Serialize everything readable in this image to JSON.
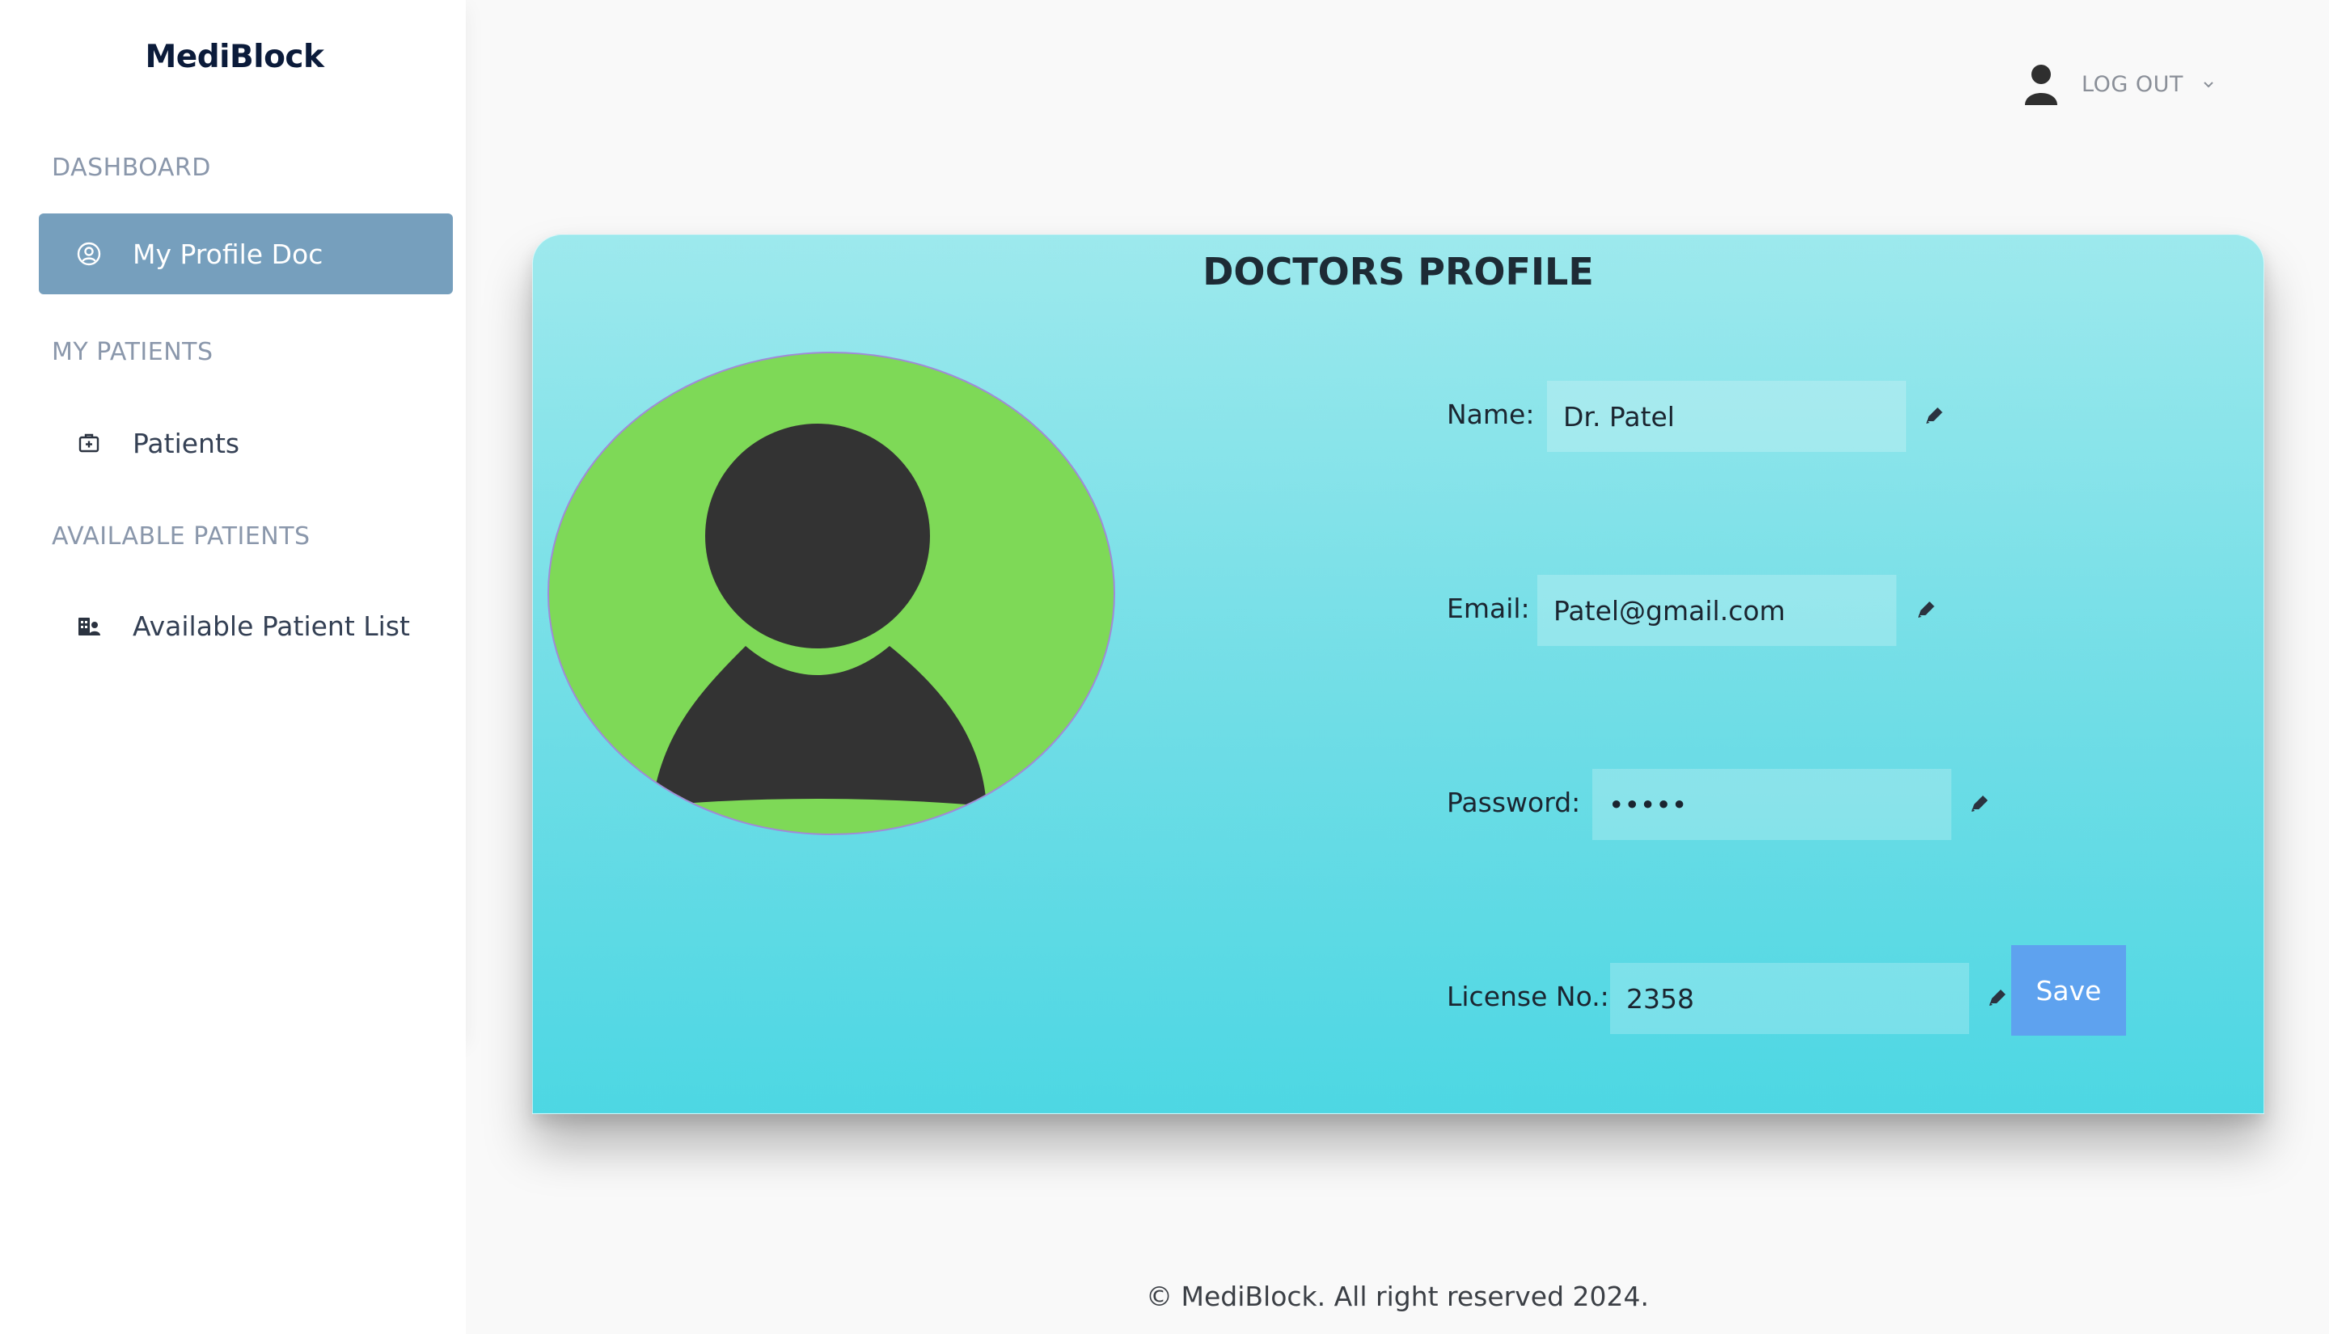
{
  "sidebar": {
    "brand": "MediBlock",
    "sections": [
      {
        "label": "DASHBOARD"
      },
      {
        "label": "MY PATIENTS"
      },
      {
        "label": "AVAILABLE PATIENTS"
      }
    ],
    "items": [
      {
        "label": "My Profile Doc",
        "icon": "user-circle-icon",
        "active": true
      },
      {
        "label": "Patients",
        "icon": "medical-briefcase-icon",
        "active": false
      },
      {
        "label": "Available Patient List",
        "icon": "hospital-user-icon",
        "active": false
      }
    ]
  },
  "topbar": {
    "logout_label": "LOG OUT",
    "user_icon": "user-icon",
    "dropdown_icon": "chevron-down-icon"
  },
  "profile": {
    "title": "DOCTORS PROFILE",
    "avatar_icon": "avatar-placeholder-icon",
    "fields": [
      {
        "label": "Name:",
        "value": "Dr. Patel"
      },
      {
        "label": "Email:",
        "value": "Patel@gmail.com"
      },
      {
        "label": "Password:",
        "value": "•••••"
      },
      {
        "label": "License No.:",
        "value": "2358"
      }
    ],
    "edit_icon": "pencil-icon",
    "save_label": "Save"
  },
  "footer": {
    "text": "© MediBlock. All right reserved 2024."
  },
  "colors": {
    "sidebar_active": "#769fbd",
    "card_gradient_top": "#9de9ed",
    "card_gradient_bottom": "#4dd7e3",
    "avatar_bg": "#7ed957",
    "save_button": "#5ea2ef"
  }
}
